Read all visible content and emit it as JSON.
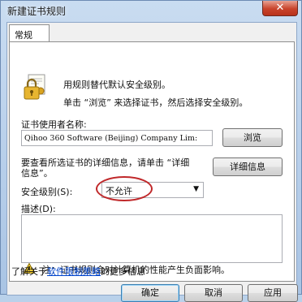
{
  "window": {
    "title": "新建证书规则",
    "close_label": "✕"
  },
  "tabs": [
    {
      "label": "常规"
    }
  ],
  "intro": {
    "line1": "用规则替代默认安全级别。",
    "line2": "单击 “浏览” 来选择证书，然后选择安全级别。"
  },
  "publisher": {
    "label": "证书使用者名称:",
    "value": "Qihoo 360 Software (Beijing) Company Lim:",
    "browse_button": "浏览"
  },
  "details": {
    "text_line1": "要查看所选证书的详细信息，请单击 “详细",
    "text_line2": "信息”。",
    "button": "详细信息"
  },
  "security": {
    "label": "安全级别(S):",
    "selected": "不允许"
  },
  "description": {
    "label": "描述(D):",
    "value": ""
  },
  "note": {
    "text": "注：证书规则会对计算机的性能产生负面影响。"
  },
  "more_info": {
    "prefix": "了解关于",
    "link": "软件限制策略",
    "suffix": "的更多信息"
  },
  "footer": {
    "ok": "确定",
    "cancel": "取消",
    "apply": "应用"
  },
  "colors": {
    "highlight_circle": "#c0282a",
    "link": "#0044cc"
  },
  "icons": {
    "lock": "lock-certificate-icon",
    "warning": "warning-icon",
    "close": "close-icon",
    "dropdown": "chevron-down-icon"
  }
}
